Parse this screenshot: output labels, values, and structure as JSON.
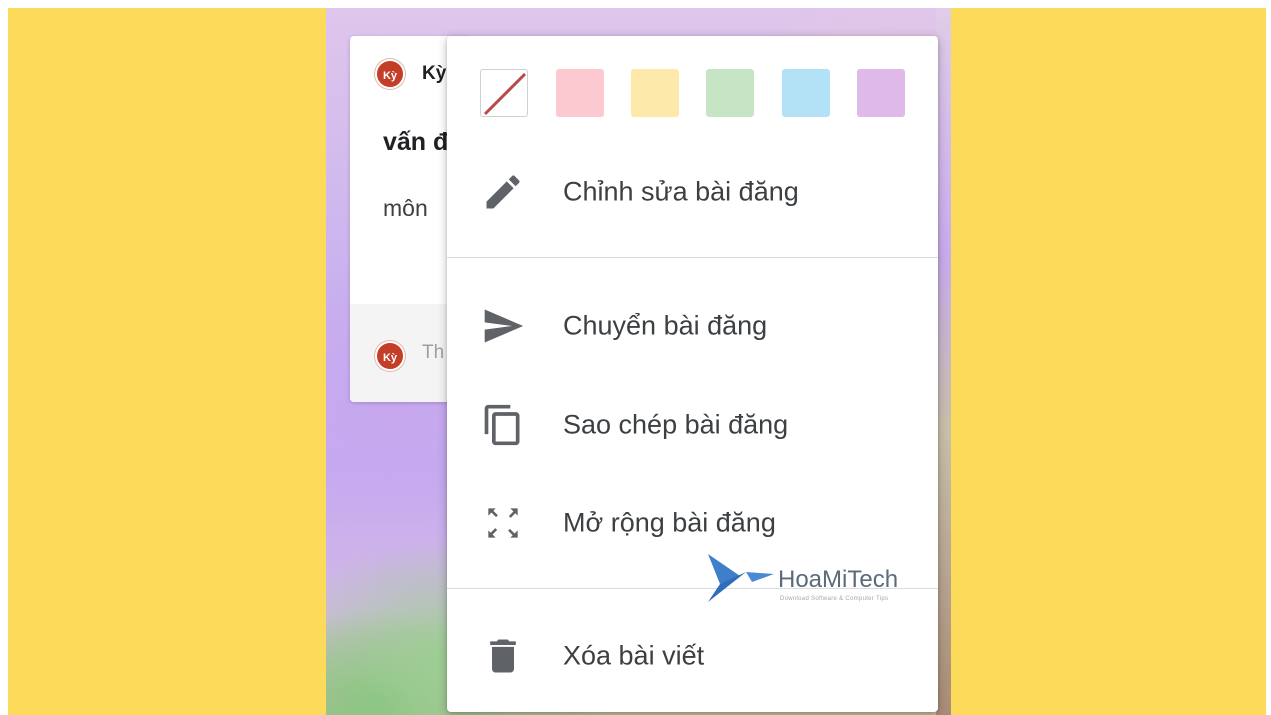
{
  "note": {
    "author_initials": "Kỳ",
    "author_name": "Kỳ",
    "title_fragment": "vấn đ",
    "body_fragment": "môn",
    "comment_placeholder": "Th"
  },
  "color_options": [
    {
      "name": "no-color",
      "color": "#ffffff"
    },
    {
      "name": "pink",
      "color": "#fbc9cf"
    },
    {
      "name": "yellow",
      "color": "#fde9a9"
    },
    {
      "name": "green",
      "color": "#c6e5c5"
    },
    {
      "name": "blue",
      "color": "#b3e1f6"
    },
    {
      "name": "purple",
      "color": "#deb9ea"
    }
  ],
  "menu": {
    "edit_label": "Chỉnh sửa bài đăng",
    "move_label": "Chuyển bài đăng",
    "copy_label": "Sao chép bài đăng",
    "expand_label": "Mở rộng bài đăng",
    "delete_label": "Xóa bài viết"
  },
  "watermark": {
    "brand": "HoaMiTech",
    "tagline": "Download Software & Computer Tips"
  },
  "colors": {
    "page_frame": "#fddb5a",
    "avatar": "#c43d27",
    "icon_gray": "#5f6368",
    "text": "#3c4043"
  }
}
